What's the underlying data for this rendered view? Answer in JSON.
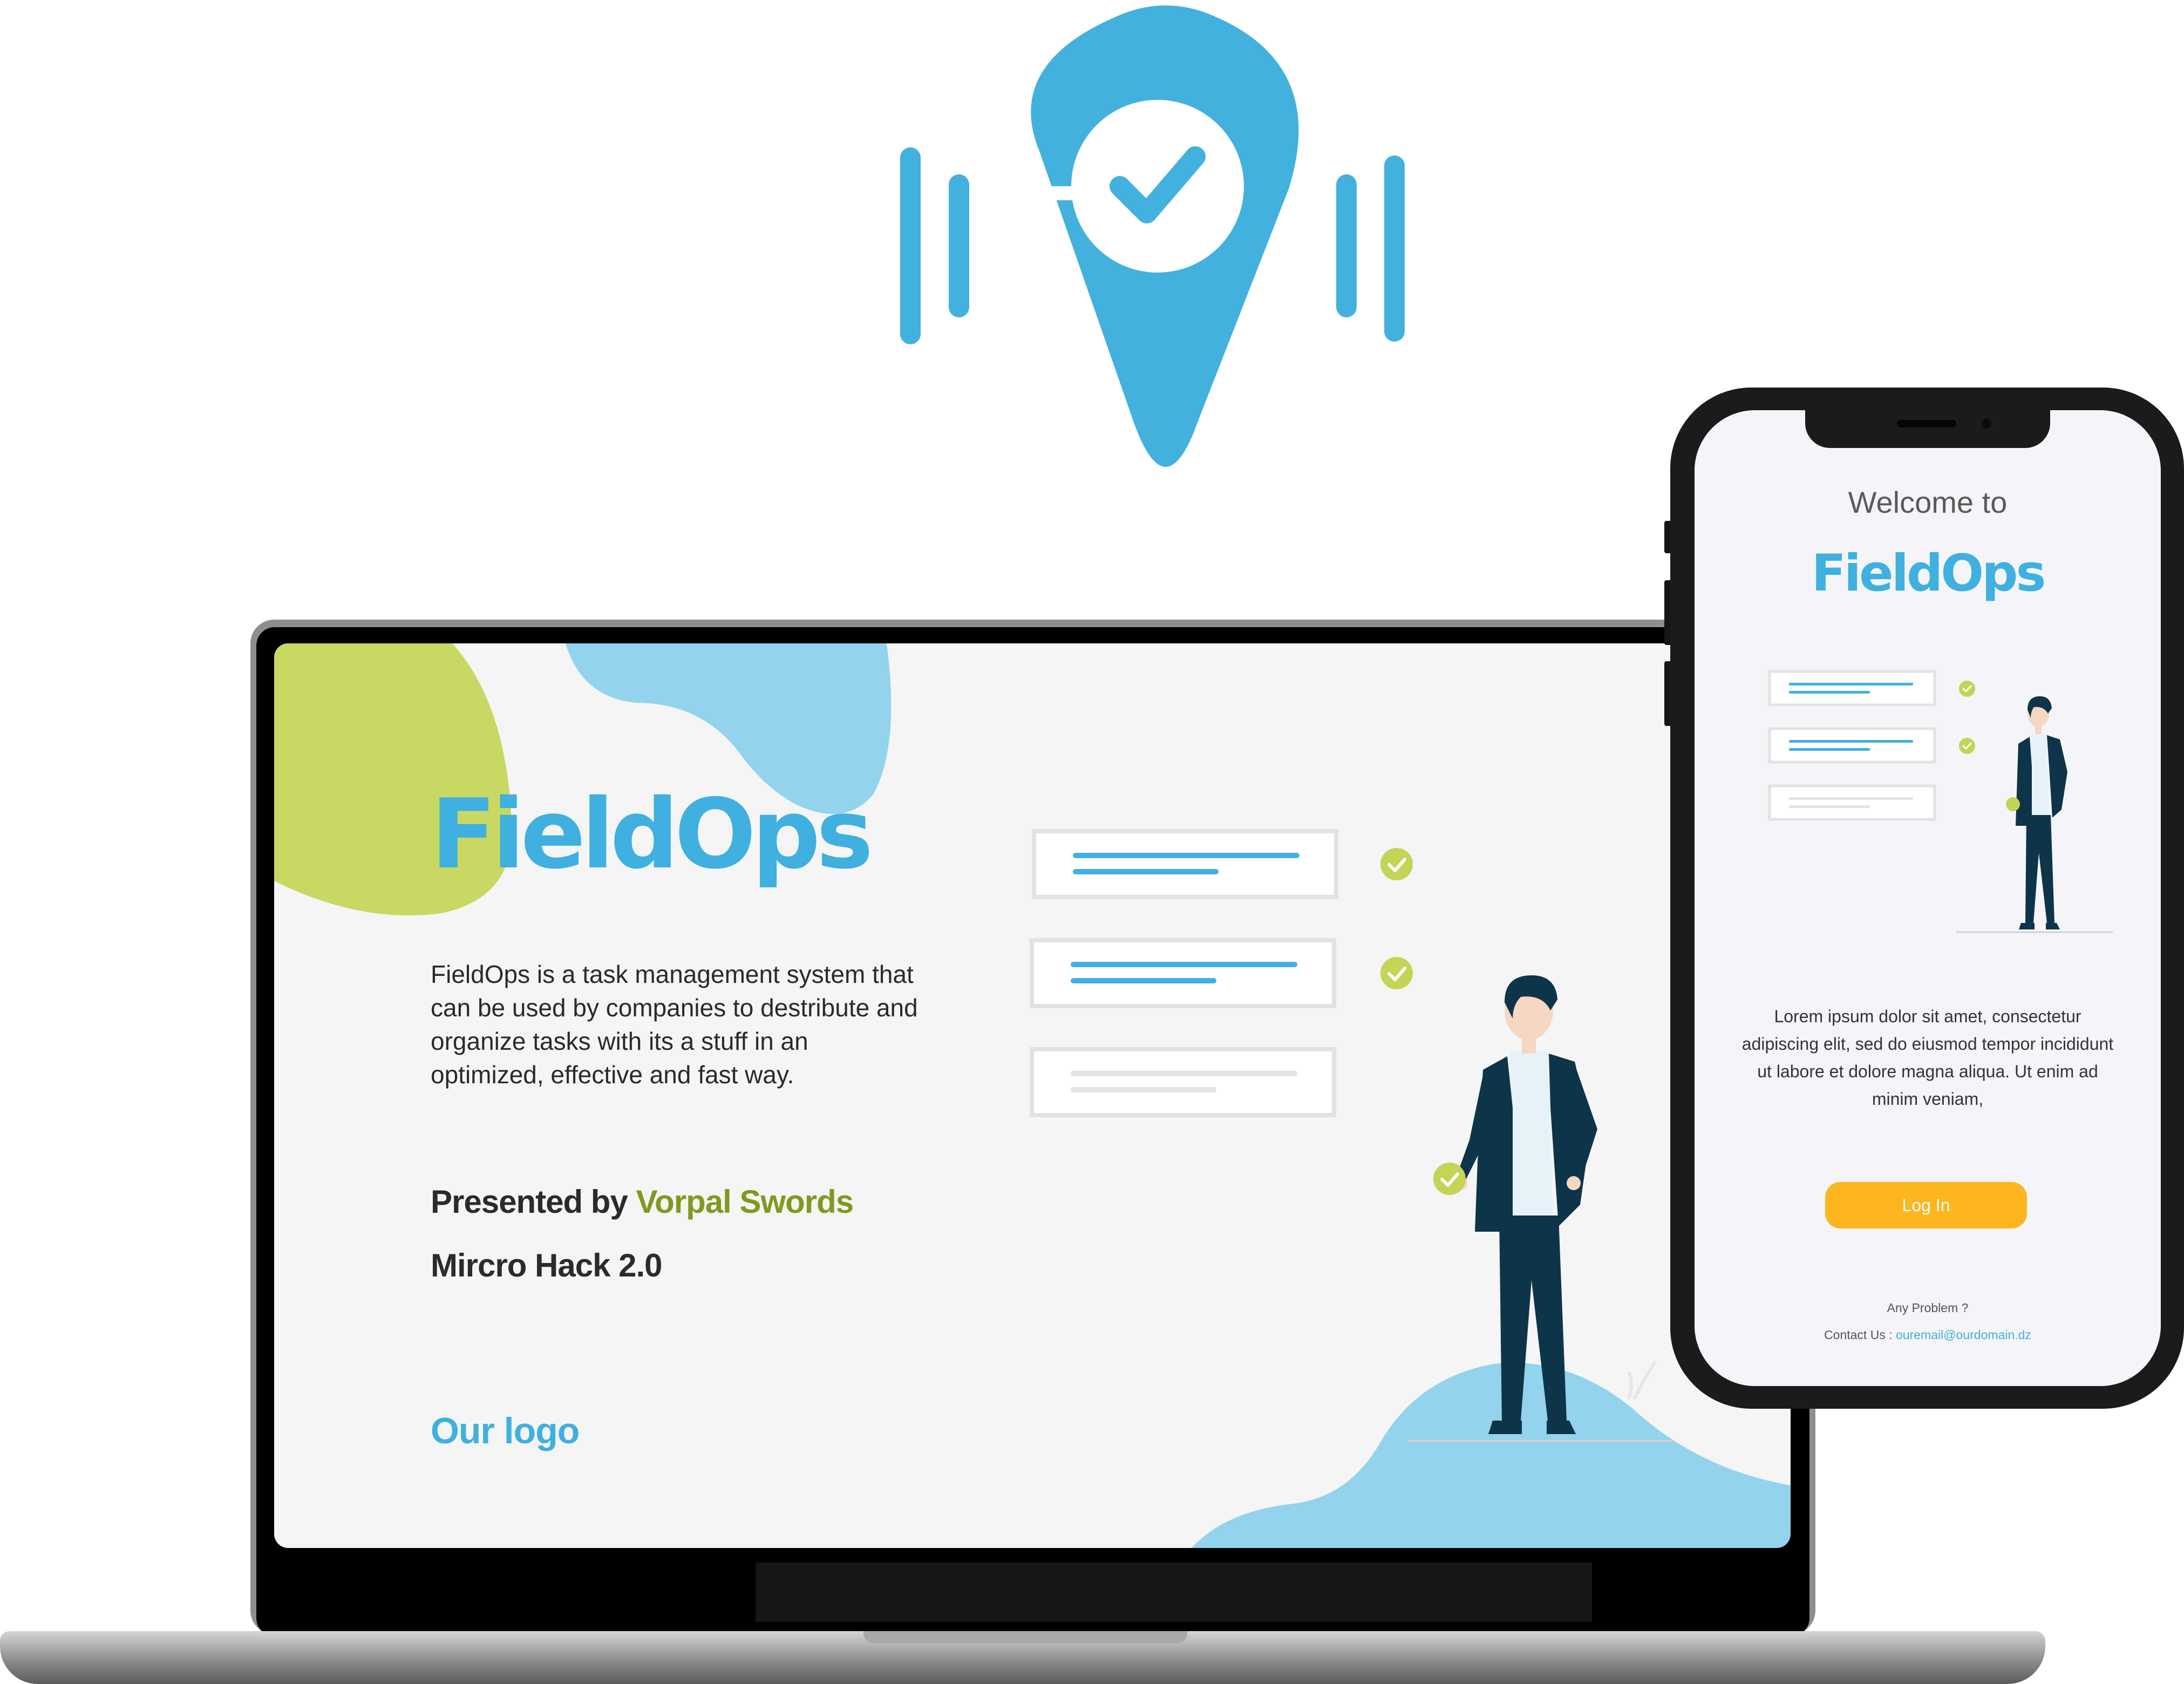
{
  "brand": {
    "logo_icon": "location-pin-check-icon",
    "primary_color": "#3fb0df",
    "accent_green": "#c8d862",
    "button_color": "#fdb520"
  },
  "desktop": {
    "title": "FieldOps",
    "description": "FieldOps is a task management system that can be used by companies to destribute and organize tasks with its a stuff in an optimized, effective and fast way.",
    "presented_by": "Presented by",
    "team_name": "Vorpal Swords",
    "event": "Mircro Hack 2.0",
    "logo_label": "Our logo"
  },
  "mobile": {
    "welcome": "Welcome to",
    "title": "FieldOps",
    "body": "Lorem ipsum dolor sit amet, consectetur adipiscing elit, sed do eiusmod tempor incididunt ut labore et dolore magna aliqua. Ut enim ad minim veniam,",
    "login_label": "Log In",
    "problem_text": "Any Problem ?",
    "contact_label": "Contact Us : ",
    "contact_email": "ouremail@ourdomain.dz"
  }
}
